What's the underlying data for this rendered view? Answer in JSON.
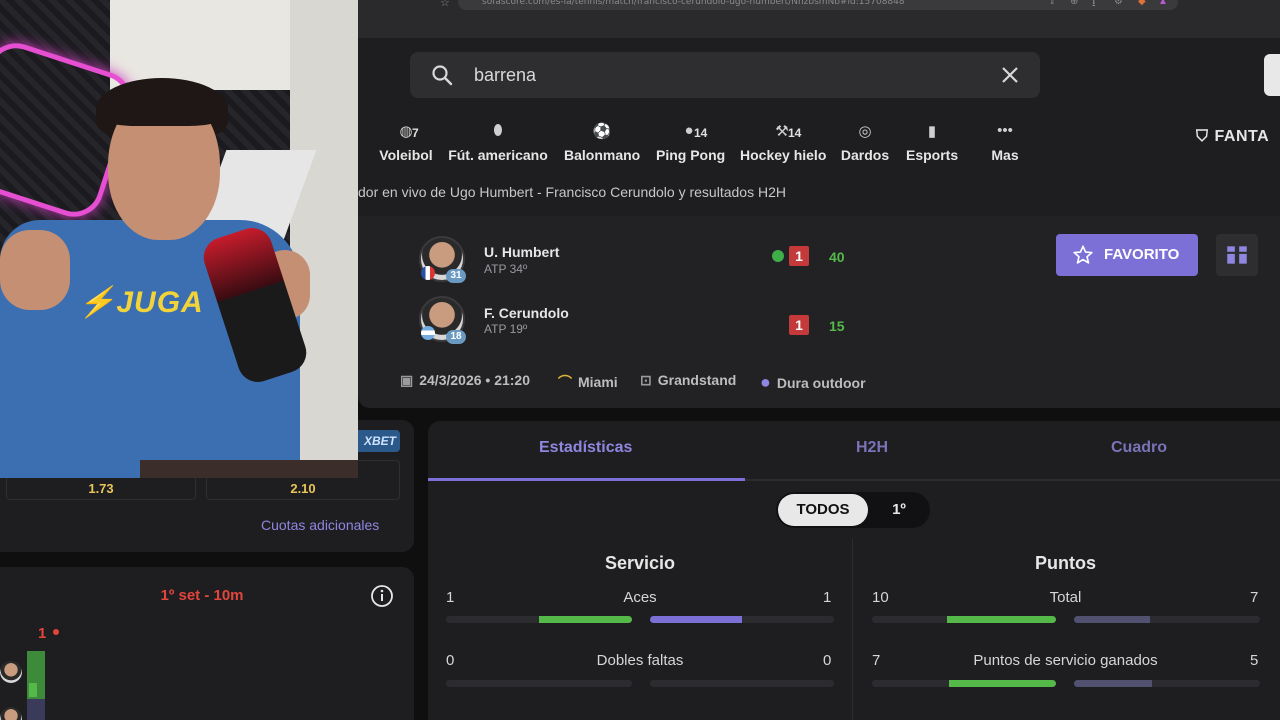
{
  "browser": {
    "url": "sofascore.com/es-la/tennis/match/francisco-cerundolo-ugo-humbert/NnzbsmNb#id:15708848"
  },
  "search": {
    "value": "barrena"
  },
  "sports": [
    {
      "label": "Voleibol",
      "count": "7",
      "icon": "volleyball-icon"
    },
    {
      "label": "Fút. americano",
      "count": "",
      "icon": "american-football-icon"
    },
    {
      "label": "Balonmano",
      "count": "",
      "icon": "handball-icon"
    },
    {
      "label": "Ping Pong",
      "count": "14",
      "icon": "table-tennis-icon"
    },
    {
      "label": "Hockey hielo",
      "count": "14",
      "icon": "ice-hockey-icon"
    },
    {
      "label": "Dardos",
      "count": "",
      "icon": "darts-icon"
    },
    {
      "label": "Esports",
      "count": "",
      "icon": "esports-icon"
    },
    {
      "label": "Mas",
      "count": "",
      "icon": "more-icon"
    }
  ],
  "fantasy_label": "FANTA",
  "breadcrumb": "dor en vivo de Ugo Humbert - Francisco Cerundolo y resultados H2H",
  "match": {
    "players": [
      {
        "name": "U. Humbert",
        "rank": "ATP 34º",
        "seed": "31",
        "sets": "1",
        "points": "40",
        "serving": true
      },
      {
        "name": "F. Cerundolo",
        "rank": "ATP 19º",
        "seed": "18",
        "sets": "1",
        "points": "15",
        "serving": false
      }
    ],
    "favorite_label": "FAVORITO",
    "date": "24/3/2026 • 21:20",
    "city": "Miami",
    "court": "Grandstand",
    "surface": "Dura outdoor"
  },
  "odds": {
    "home": "1.73",
    "away": "2.10",
    "more_label": "Cuotas adicionales",
    "bookmaker": "XBET"
  },
  "momentum": {
    "title": "1º set - 10m",
    "set_label": "1"
  },
  "stats": {
    "tabs": [
      "Estadísticas",
      "H2H",
      "Cuadro"
    ],
    "period_on": "TODOS",
    "period_off": "1º",
    "left": {
      "title": "Servicio",
      "rows": [
        {
          "label": "Aces",
          "home": "1",
          "away": "1",
          "home_frac": 0.5,
          "away_frac": 0.5
        },
        {
          "label": "Dobles faltas",
          "home": "0",
          "away": "0",
          "home_frac": 0,
          "away_frac": 0
        }
      ]
    },
    "right": {
      "title": "Puntos",
      "rows": [
        {
          "label": "Total",
          "home": "10",
          "away": "7",
          "home_frac": 0.59,
          "away_frac": 0.41
        },
        {
          "label": "Puntos de servicio ganados",
          "home": "7",
          "away": "5",
          "home_frac": 0.58,
          "away_frac": 0.42
        }
      ]
    }
  },
  "colors": {
    "accent": "#7c6fd6",
    "win": "#54b948",
    "loss": "#c43a3a",
    "odds": "#e7c55a"
  }
}
